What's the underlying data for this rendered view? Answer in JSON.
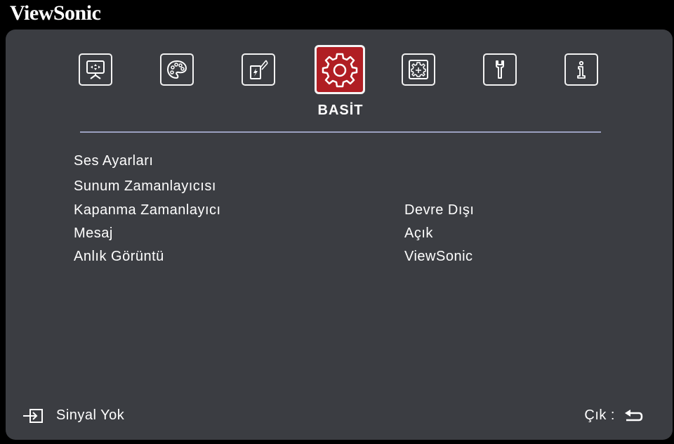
{
  "brand": "ViewSonic",
  "tabs": [
    {
      "icon": "display-icon"
    },
    {
      "icon": "palette-icon"
    },
    {
      "icon": "power-bolt-icon"
    },
    {
      "icon": "gear-icon",
      "active": true
    },
    {
      "icon": "advanced-gear-icon"
    },
    {
      "icon": "wrench-icon"
    },
    {
      "icon": "info-icon"
    }
  ],
  "active_tab_label": "BASİT",
  "menu": [
    {
      "label": "Ses Ayarları",
      "value": ""
    },
    {
      "label": "Sunum Zamanlayıcısı",
      "value": ""
    },
    {
      "label": "Kapanma Zamanlayıcı",
      "value": "Devre Dışı"
    },
    {
      "label": "Mesaj",
      "value": "Açık"
    },
    {
      "label": "Anlık Görüntü",
      "value": "ViewSonic"
    }
  ],
  "footer": {
    "status": "Sinyal Yok",
    "exit_label": "Çık :"
  },
  "colors": {
    "panel": "#3b3d42",
    "active_tab": "#b01e23",
    "separator": "#9aa0c0",
    "text": "#ffffff"
  }
}
